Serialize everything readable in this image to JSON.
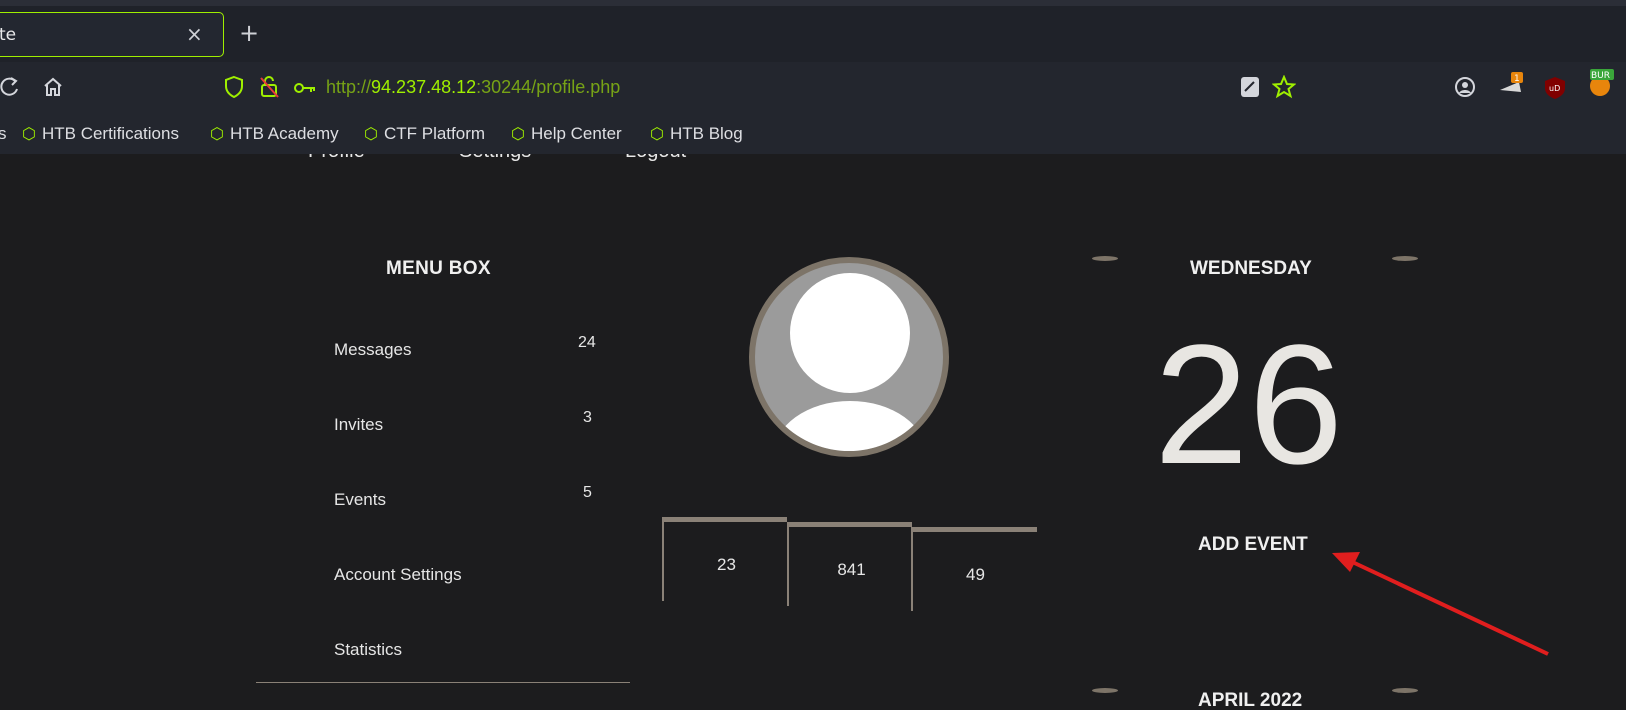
{
  "browser": {
    "tab_title": "te",
    "tab_close": "×",
    "new_tab": "+",
    "url_prefix": "http://",
    "url_host": "94.237.48.12",
    "url_rest": ":30244/profile.php",
    "extension_badge": "1",
    "extension_label": "BUR",
    "bookmarks": [
      {
        "label": "s"
      },
      {
        "label": "HTB Certifications"
      },
      {
        "label": "HTB Academy"
      },
      {
        "label": "CTF Platform"
      },
      {
        "label": "Help Center"
      },
      {
        "label": "HTB Blog"
      }
    ],
    "accent_color": "#9fef00"
  },
  "page": {
    "nav": [
      "Profile",
      "Settings",
      "Logout"
    ],
    "menu_box": {
      "title": "MENU BOX",
      "items": [
        {
          "label": "Messages",
          "count": "24"
        },
        {
          "label": "Invites",
          "count": "3"
        },
        {
          "label": "Events",
          "count": "5"
        },
        {
          "label": "Account Settings",
          "count": ""
        },
        {
          "label": "Statistics",
          "count": ""
        }
      ]
    },
    "stats": [
      "23",
      "841",
      "49"
    ],
    "calendar": {
      "weekday": "WEDNESDAY",
      "day": "26",
      "add_event": "ADD EVENT",
      "month": "APRIL 2022"
    }
  }
}
